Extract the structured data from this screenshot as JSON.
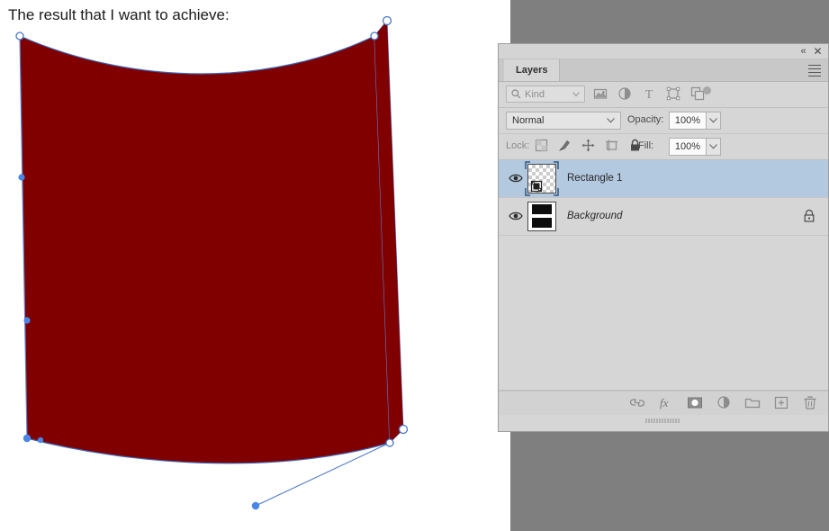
{
  "canvas": {
    "caption": "The result that I want to achieve:",
    "shape": {
      "name": "curved-rectangle-shape",
      "fill_color": "#800000",
      "path_stroke_color": "#2b4fa8",
      "anchor_color_selected": "#4a86e8",
      "anchor_color_unselected": "#ffffff"
    },
    "background_color": "#ffffff",
    "desktop_color": "#7f7f7f"
  },
  "panel": {
    "titlebar": {
      "collapse_label": "«",
      "close_label": "✕"
    },
    "tab_label": "Layers",
    "menu_icon": "hamburger-menu-icon",
    "filter": {
      "search_icon": "search-icon",
      "placeholder": "Kind",
      "dropdown_caret": "chevron-down-icon",
      "icons": [
        "pixel-layers-filter-icon",
        "adjustment-layers-filter-icon",
        "type-layers-filter-icon",
        "shape-layers-filter-icon",
        "smart-object-filter-icon"
      ],
      "toggle_icon": "filter-toggle-icon"
    },
    "blend": {
      "mode": "Normal",
      "opacity_label": "Opacity:",
      "opacity_value": "100%"
    },
    "lock": {
      "label": "Lock:",
      "icons": [
        "lock-transparent-pixels-icon",
        "lock-image-pixels-icon",
        "lock-position-icon",
        "lock-artboard-nesting-icon",
        "lock-all-icon"
      ],
      "fill_label": "Fill:",
      "fill_value": "100%"
    },
    "layers": [
      {
        "name": "Rectangle 1",
        "visible": true,
        "selected": true,
        "locked": false,
        "italic": false,
        "thumbnail": "shape-vector-thumbnail"
      },
      {
        "name": "Background",
        "visible": true,
        "selected": false,
        "locked": true,
        "italic": true,
        "thumbnail": "background-black-white-thumbnail"
      }
    ],
    "footer_icons": [
      "link-layers-icon",
      "layer-style-fx-icon",
      "add-layer-mask-icon",
      "new-adjustment-layer-icon",
      "new-group-icon",
      "new-layer-icon",
      "delete-layer-icon"
    ],
    "resize_grip": "panel-resize-grip",
    "colors": {
      "panel_bg": "#d6d6d6",
      "selected_row": "#b3c9e0",
      "border": "#9e9e9e"
    }
  }
}
